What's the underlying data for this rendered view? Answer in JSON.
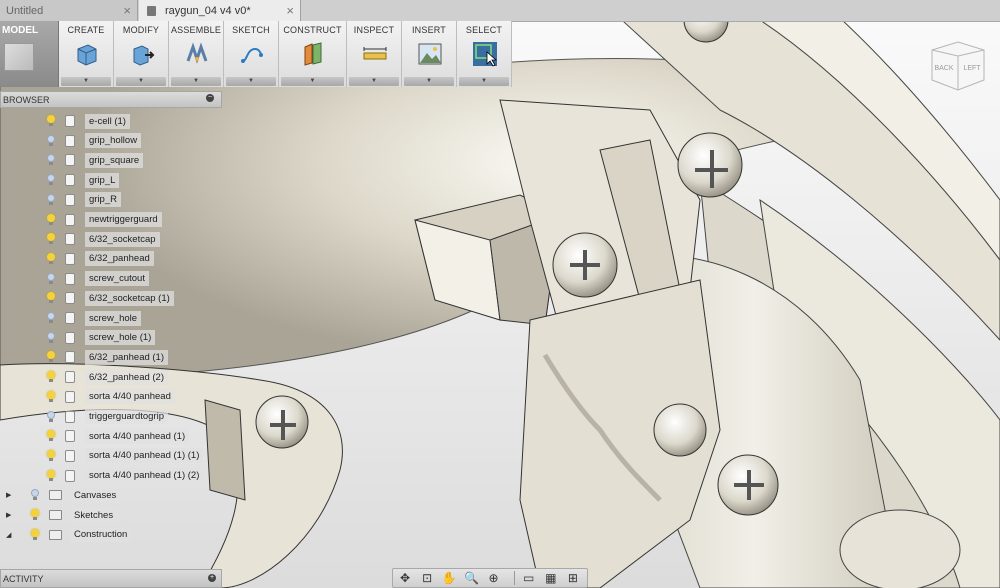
{
  "tabs": [
    {
      "title": "Untitled",
      "close": "×"
    },
    {
      "title": "raygun_04 v4 v0*",
      "close": "×"
    }
  ],
  "workspace": {
    "label": "MODEL"
  },
  "toolbar": [
    {
      "label": "CREATE",
      "icon": "box-icon"
    },
    {
      "label": "MODIFY",
      "icon": "press-pull-icon"
    },
    {
      "label": "ASSEMBLE",
      "icon": "joint-icon"
    },
    {
      "label": "SKETCH",
      "icon": "sketch-arc-icon"
    },
    {
      "label": "CONSTRUCT",
      "icon": "plane-icon"
    },
    {
      "label": "INSPECT",
      "icon": "measure-icon"
    },
    {
      "label": "INSERT",
      "icon": "image-icon"
    },
    {
      "label": "SELECT",
      "icon": "select-cursor-icon"
    }
  ],
  "dropdown_arrow": "▼",
  "browser": {
    "title": "BROWSER",
    "items": [
      {
        "label": "e-cell (1)",
        "visible": true
      },
      {
        "label": "grip_hollow",
        "visible": false
      },
      {
        "label": "grip_square",
        "visible": false
      },
      {
        "label": "grip_L",
        "visible": false
      },
      {
        "label": "grip_R",
        "visible": false
      },
      {
        "label": "newtriggerguard",
        "visible": true
      },
      {
        "label": "6/32_socketcap",
        "visible": true
      },
      {
        "label": "6/32_panhead",
        "visible": true
      },
      {
        "label": "screw_cutout",
        "visible": false
      },
      {
        "label": "6/32_socketcap (1)",
        "visible": true
      },
      {
        "label": "screw_hole",
        "visible": false
      },
      {
        "label": "screw_hole (1)",
        "visible": false
      },
      {
        "label": "6/32_panhead (1)",
        "visible": true
      },
      {
        "label": "6/32_panhead (2)",
        "visible": true
      },
      {
        "label": "sorta 4/40 panhead",
        "visible": true
      },
      {
        "label": "triggerguardtogrip",
        "visible": false
      },
      {
        "label": "sorta 4/40 panhead (1)",
        "visible": true
      },
      {
        "label": "sorta 4/40 panhead (1) (1)",
        "visible": true
      },
      {
        "label": "sorta 4/40 panhead (1) (2)",
        "visible": true
      }
    ],
    "folders": [
      {
        "label": "Canvases",
        "visible": false,
        "arrow": "▶"
      },
      {
        "label": "Sketches",
        "visible": true,
        "arrow": "▶"
      },
      {
        "label": "Construction",
        "visible": true,
        "arrow": "◢"
      }
    ]
  },
  "activity": {
    "title": "ACTIVITY"
  },
  "viewcube": {
    "back": "BACK",
    "left": "LEFT"
  },
  "navbar": [
    {
      "icon": "orbit-icon",
      "glyph": "✥"
    },
    {
      "icon": "look-at-icon",
      "glyph": "⊡"
    },
    {
      "icon": "pan-icon",
      "glyph": "✋"
    },
    {
      "icon": "zoom-window-icon",
      "glyph": "🔍"
    },
    {
      "icon": "zoom-icon",
      "glyph": "⊕"
    },
    {
      "icon": "display-settings-icon",
      "glyph": "▭"
    },
    {
      "icon": "grid-icon",
      "glyph": "▦"
    },
    {
      "icon": "viewports-icon",
      "glyph": "⊞"
    }
  ],
  "colors": {
    "bulb_on": "#f5d23a",
    "bulb_off": "#c8d6e8",
    "model": "#e4e1d6",
    "select_active": "#3b6ea0"
  }
}
